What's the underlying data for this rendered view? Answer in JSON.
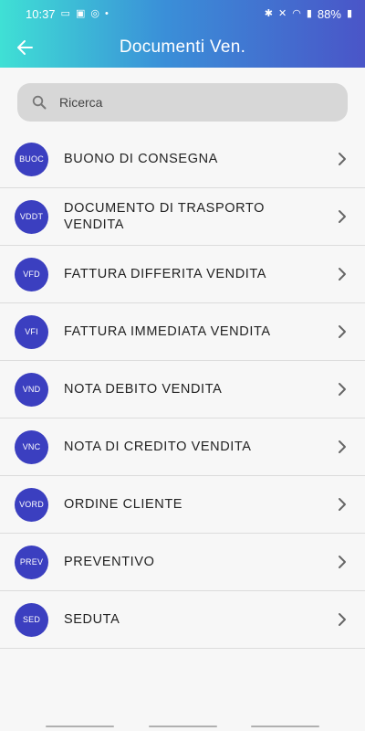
{
  "status": {
    "time": "10:37",
    "battery": "88%"
  },
  "toolbar": {
    "title": "Documenti Ven."
  },
  "search": {
    "placeholder": "Ricerca"
  },
  "items": [
    {
      "code": "BUOC",
      "label": "BUONO DI CONSEGNA"
    },
    {
      "code": "VDDT",
      "label": "DOCUMENTO DI TRASPORTO VENDITA"
    },
    {
      "code": "VFD",
      "label": "FATTURA DIFFERITA VENDITA"
    },
    {
      "code": "VFI",
      "label": "FATTURA IMMEDIATA VENDITA"
    },
    {
      "code": "VND",
      "label": "NOTA DEBITO VENDITA"
    },
    {
      "code": "VNC",
      "label": "NOTA DI CREDITO VENDITA"
    },
    {
      "code": "VORD",
      "label": "ORDINE CLIENTE"
    },
    {
      "code": "PREV",
      "label": "PREVENTIVO"
    },
    {
      "code": "SED",
      "label": "SEDUTA"
    }
  ],
  "colors": {
    "badge": "#3b3fc0",
    "header_start": "#3fe0d5",
    "header_end": "#4a55c8"
  }
}
